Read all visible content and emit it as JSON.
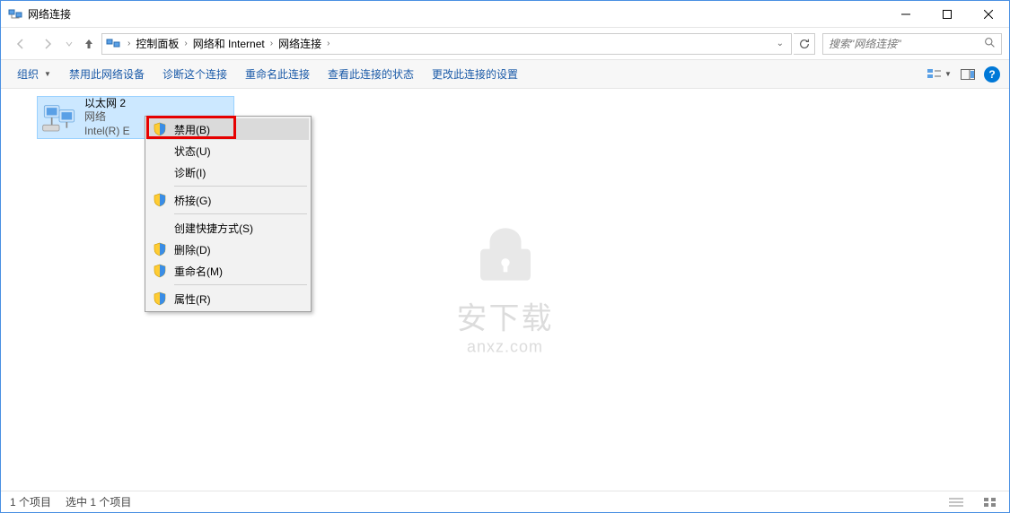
{
  "window": {
    "title": "网络连接"
  },
  "breadcrumb": {
    "items": [
      "控制面板",
      "网络和 Internet",
      "网络连接"
    ]
  },
  "search": {
    "placeholder": "搜索\"网络连接\""
  },
  "toolbar": {
    "organize": "组织",
    "items": [
      "禁用此网络设备",
      "诊断这个连接",
      "重命名此连接",
      "查看此连接的状态",
      "更改此连接的设置"
    ]
  },
  "adapter": {
    "name": "以太网 2",
    "status": "网络",
    "device": "Intel(R) E"
  },
  "contextMenu": {
    "items": [
      {
        "label": "禁用(B)",
        "shield": true,
        "highlighted": true
      },
      {
        "label": "状态(U)",
        "shield": false
      },
      {
        "label": "诊断(I)",
        "shield": false
      },
      {
        "sep": true
      },
      {
        "label": "桥接(G)",
        "shield": true
      },
      {
        "sep": true
      },
      {
        "label": "创建快捷方式(S)",
        "shield": false
      },
      {
        "label": "删除(D)",
        "shield": true
      },
      {
        "label": "重命名(M)",
        "shield": true
      },
      {
        "sep": true
      },
      {
        "label": "属性(R)",
        "shield": true
      }
    ]
  },
  "watermark": {
    "line1": "安下载",
    "line2": "anxz.com"
  },
  "statusbar": {
    "count": "1 个项目",
    "selected": "选中 1 个项目"
  }
}
